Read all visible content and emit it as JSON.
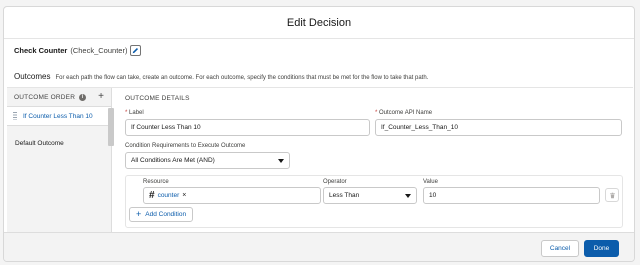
{
  "modal": {
    "title": "Edit Decision"
  },
  "decision": {
    "name": "Check Counter",
    "api_name": "(Check_Counter)"
  },
  "outcomes": {
    "label": "Outcomes",
    "help_text": "For each path the flow can take, create an outcome. For each outcome, specify the conditions that must be met for the flow to take that path."
  },
  "sidebar": {
    "order_label": "OUTCOME ORDER",
    "info_glyph": "i",
    "add_glyph": "+",
    "items": [
      {
        "label": "If Counter Less Than 10"
      }
    ],
    "default_outcome": "Default Outcome"
  },
  "details": {
    "title": "OUTCOME DETAILS",
    "label_field": {
      "label": "Label",
      "value": "If Counter Less Than 10"
    },
    "api_field": {
      "label": "Outcome API Name",
      "value": "If_Counter_Less_Than_10"
    },
    "requirements": {
      "label": "Condition Requirements to Execute Outcome",
      "value": "All Conditions Are Met (AND)"
    },
    "condition": {
      "resource_label": "Resource",
      "resource_value": "counter",
      "operator_label": "Operator",
      "operator_value": "Less Than",
      "value_label": "Value",
      "value_value": "10"
    },
    "add_condition": "Add Condition"
  },
  "footer": {
    "cancel": "Cancel",
    "done": "Done"
  },
  "icons": {
    "pencil": "pencil-icon",
    "info": "info-icon",
    "add": "add-icon",
    "drag": "drag-handle-icon",
    "hash": "number-variable-icon",
    "remove": "close-icon",
    "caret": "chevron-down-icon",
    "trash": "trash-icon",
    "plus": "plus-icon"
  },
  "colors": {
    "brand": "#0b5cab",
    "required": "#c23934"
  }
}
